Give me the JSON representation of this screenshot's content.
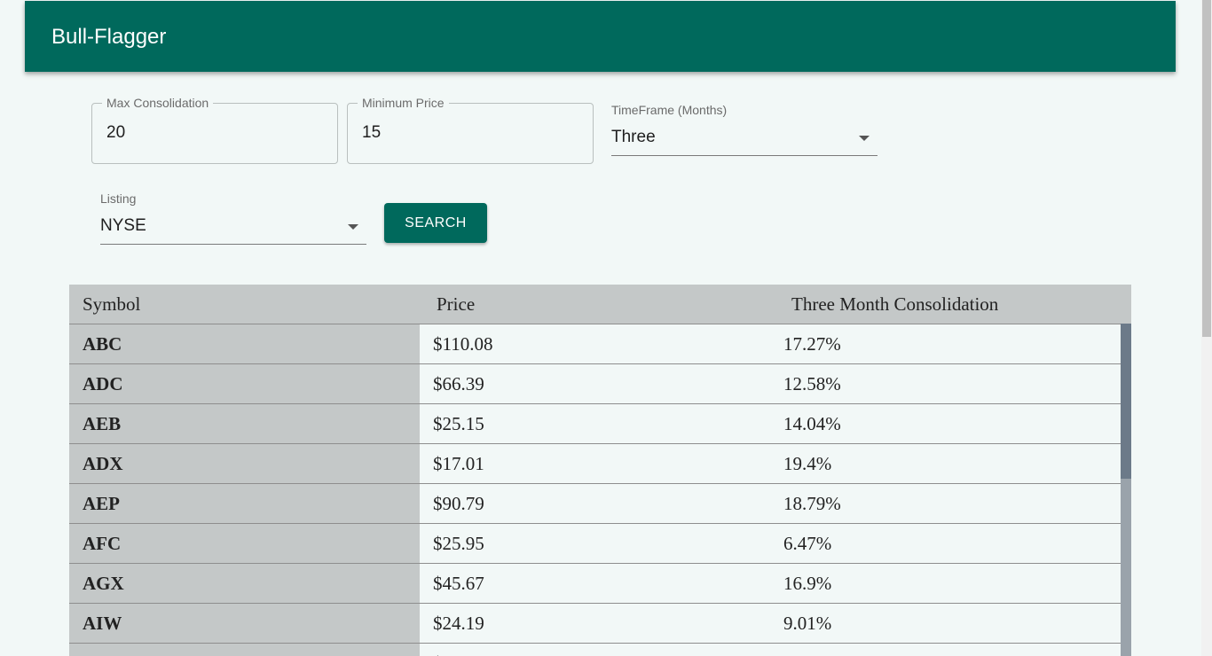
{
  "app": {
    "title": "Bull-Flagger"
  },
  "filters": {
    "max_consolidation": {
      "label": "Max Consolidation",
      "value": "20"
    },
    "minimum_price": {
      "label": "Minimum Price",
      "value": "15"
    },
    "timeframe": {
      "label": "TimeFrame (Months)",
      "value": "Three"
    },
    "listing": {
      "label": "Listing",
      "value": "NYSE"
    },
    "search_label": "SEARCH"
  },
  "table": {
    "headers": {
      "symbol": "Symbol",
      "price": "Price",
      "consolidation": "Three Month Consolidation"
    },
    "rows": [
      {
        "symbol": "ABC",
        "price": "$110.08",
        "consolidation": "17.27%"
      },
      {
        "symbol": "ADC",
        "price": "$66.39",
        "consolidation": "12.58%"
      },
      {
        "symbol": "AEB",
        "price": "$25.15",
        "consolidation": "14.04%"
      },
      {
        "symbol": "ADX",
        "price": "$17.01",
        "consolidation": "19.4%"
      },
      {
        "symbol": "AEP",
        "price": "$90.79",
        "consolidation": "18.79%"
      },
      {
        "symbol": "AFC",
        "price": "$25.95",
        "consolidation": "6.47%"
      },
      {
        "symbol": "AGX",
        "price": "$45.67",
        "consolidation": "16.9%"
      },
      {
        "symbol": "AIW",
        "price": "$24.19",
        "consolidation": "9.01%"
      },
      {
        "symbol": "",
        "price": "$",
        "consolidation": ""
      }
    ]
  },
  "colors": {
    "primary": "#00695c",
    "background": "#f2f8f7",
    "symbol_column": "#c4c8c8"
  },
  "icons": {
    "select_caret": "caret-down-icon"
  }
}
